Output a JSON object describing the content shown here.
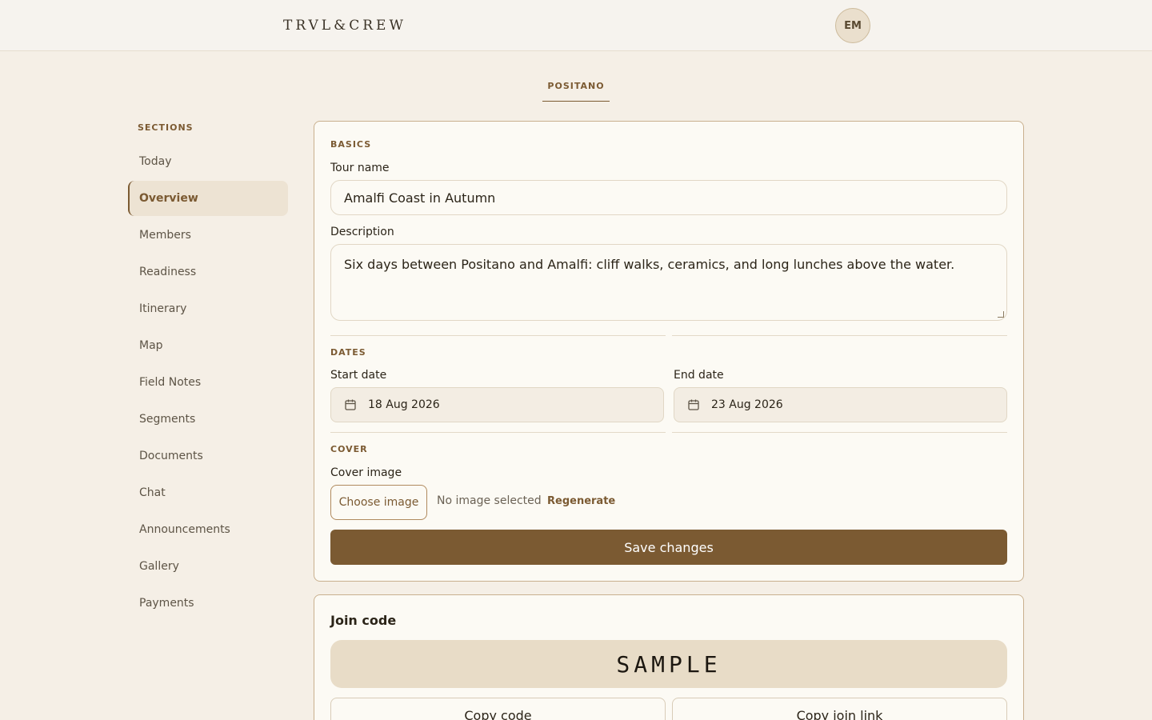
{
  "brand": {
    "logo": "TRVL&CREW",
    "avatar_initials": "EM"
  },
  "tab": {
    "label": "POSITANO"
  },
  "sidebar": {
    "title": "SECTIONS",
    "items": [
      {
        "label": "Today"
      },
      {
        "label": "Overview"
      },
      {
        "label": "Members"
      },
      {
        "label": "Readiness"
      },
      {
        "label": "Itinerary"
      },
      {
        "label": "Map"
      },
      {
        "label": "Field Notes"
      },
      {
        "label": "Segments"
      },
      {
        "label": "Documents"
      },
      {
        "label": "Chat"
      },
      {
        "label": "Announcements"
      },
      {
        "label": "Gallery"
      },
      {
        "label": "Payments"
      }
    ],
    "active_item": "Overview"
  },
  "basics": {
    "eyebrow": "BASICS",
    "tour_name_label": "Tour name",
    "tour_name_value": "Amalfi Coast in Autumn",
    "description_label": "Description",
    "description_value": "Six days between Positano and Amalfi: cliff walks, ceramics, and long lunches above the water."
  },
  "dates": {
    "eyebrow": "DATES",
    "start_label": "Start date",
    "start_value": "18 Aug 2026",
    "end_label": "End date",
    "end_value": "23 Aug 2026"
  },
  "cover": {
    "eyebrow": "COVER",
    "label": "Cover image",
    "choose_button": "Choose image",
    "status": "No image selected",
    "regenerate": "Regenerate"
  },
  "save_button": "Save changes",
  "join": {
    "title": "Join code",
    "code": "SAMPLE",
    "copy_code": "Copy code",
    "copy_link": "Copy join link"
  },
  "colors": {
    "accent": "#7b5a32",
    "page_bg": "#f5efe6",
    "card_bg": "#fcfaf4"
  }
}
